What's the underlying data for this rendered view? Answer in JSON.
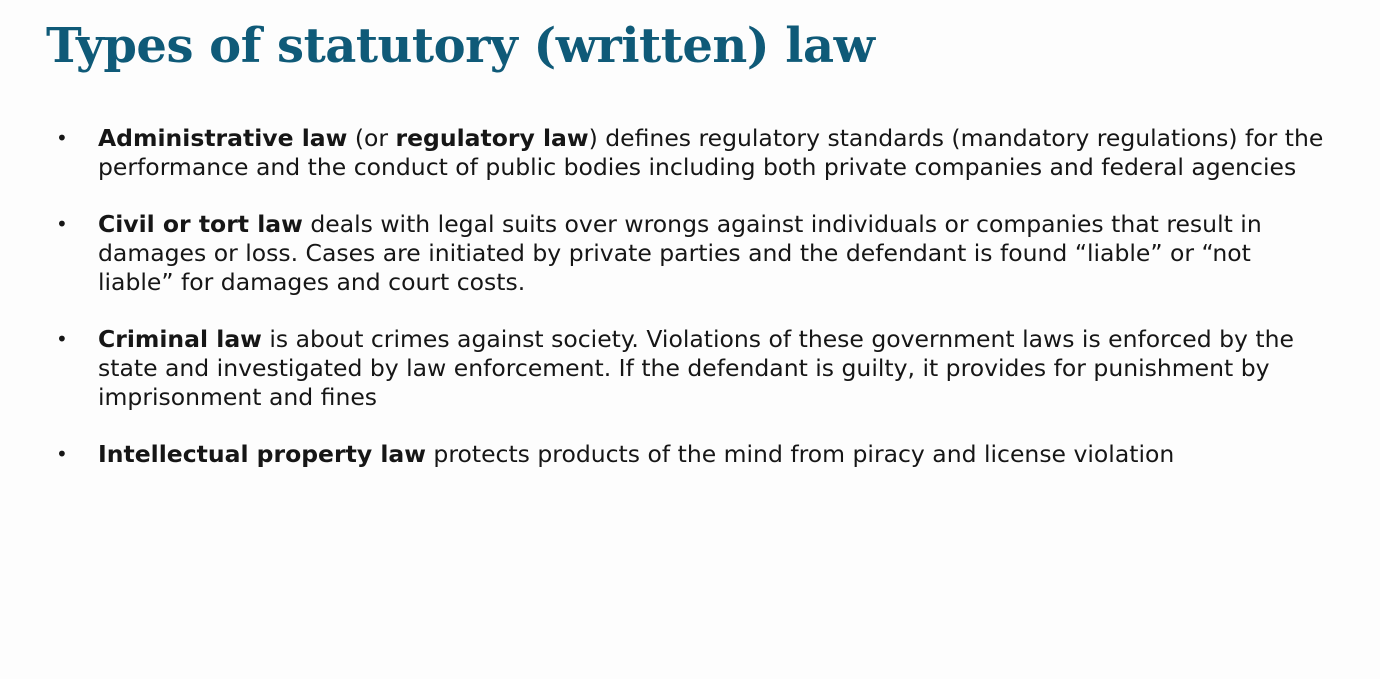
{
  "slide": {
    "title": "Types of statutory (written) law",
    "title_color": "#0f5a78",
    "text_color": "#161616",
    "bullet_glyph": "•",
    "items": [
      {
        "segments": [
          {
            "text": "Administrative law",
            "bold": true
          },
          {
            "text": " (or ",
            "bold": false
          },
          {
            "text": "regulatory law",
            "bold": true
          },
          {
            "text": ") defines regulatory standards (mandatory regulations) for the performance and the conduct of public bodies including both private companies and federal agencies",
            "bold": false
          }
        ]
      },
      {
        "segments": [
          {
            "text": "Civil or tort law",
            "bold": true
          },
          {
            "text": " deals with legal suits over wrongs against individuals or companies that result in damages or loss. Cases are initiated by private parties and the defendant is found “liable” or “not liable” for damages and court costs.",
            "bold": false
          }
        ]
      },
      {
        "segments": [
          {
            "text": "Criminal law",
            "bold": true
          },
          {
            "text": " is about crimes against society. Violations of these government laws is enforced by the state and investigated by law enforcement. If the defendant is guilty, it provides for punishment by imprisonment and fines",
            "bold": false
          }
        ]
      },
      {
        "segments": [
          {
            "text": "Intellectual property law",
            "bold": true
          },
          {
            "text": " protects products of the mind from piracy and license violation",
            "bold": false
          }
        ]
      }
    ]
  }
}
